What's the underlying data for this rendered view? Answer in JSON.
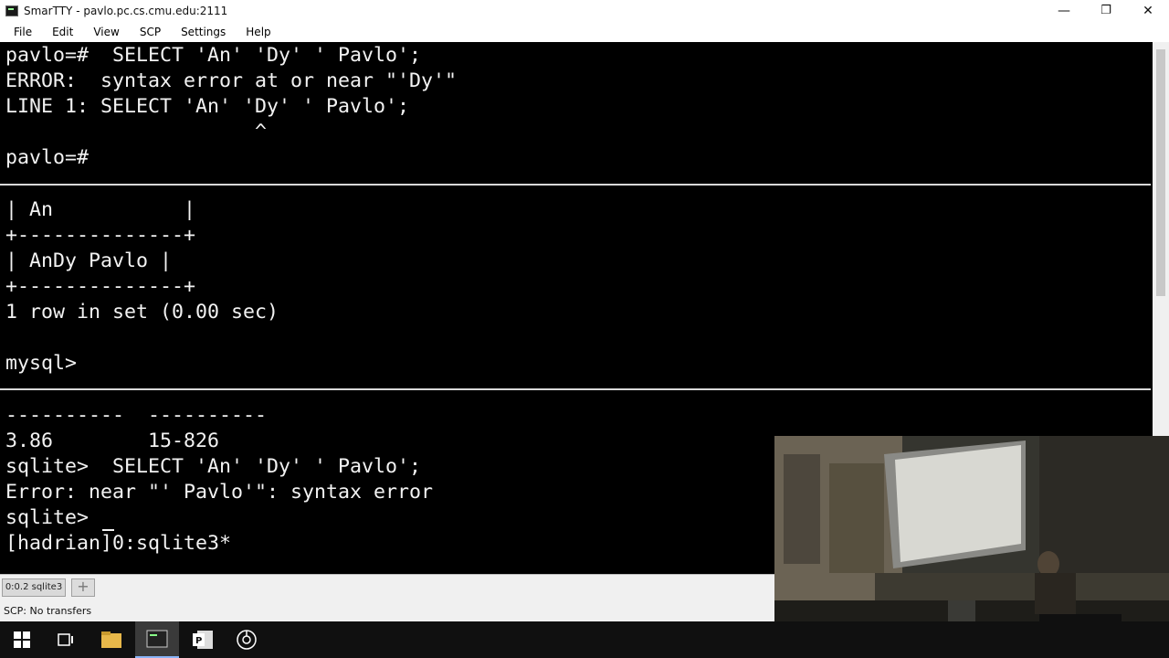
{
  "window": {
    "title": "SmarTTY - pavlo.pc.cs.cmu.edu:2111",
    "minimize": "—",
    "maximize": "❐",
    "close": "✕"
  },
  "menu": [
    "File",
    "Edit",
    "View",
    "SCP",
    "Settings",
    "Help"
  ],
  "terminal": {
    "postgres": [
      "pavlo=#  SELECT 'An' 'Dy' ' Pavlo';",
      "ERROR:  syntax error at or near \"'Dy'\"",
      "LINE 1: SELECT 'An' 'Dy' ' Pavlo';",
      "                     ^",
      "",
      "pavlo=#"
    ],
    "mysql": [
      "| An           |",
      "+--------------+",
      "| AnDy Pavlo |",
      "+--------------+",
      "1 row in set (0.00 sec)",
      "",
      "mysql>"
    ],
    "sqlite": [
      "----------  ----------",
      "3.86        15-826",
      "sqlite>  SELECT 'An' 'Dy' ' Pavlo';",
      "Error: near \"' Pavlo'\": syntax error",
      "sqlite> ",
      "[hadrian]0:sqlite3*"
    ]
  },
  "tabs": {
    "session_label": "0:0.2 sqlite3",
    "add_label": "+"
  },
  "status": "SCP: No transfers",
  "taskbar": {
    "icons": [
      "windows-start-icon",
      "task-view-icon",
      "file-explorer-icon",
      "terminal-app-icon",
      "powerpoint-icon",
      "chrome-icon"
    ]
  }
}
